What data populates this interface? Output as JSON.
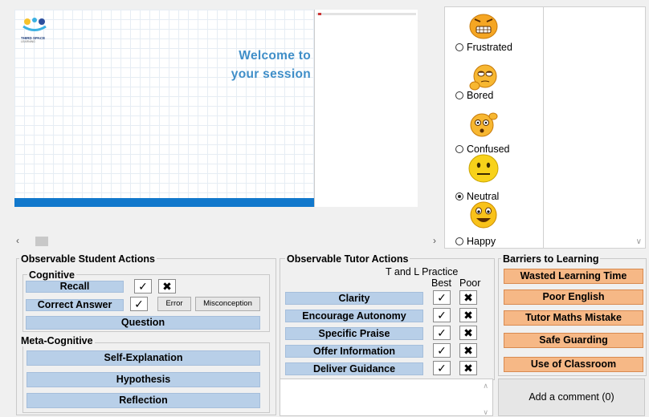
{
  "preview": {
    "logo_text": "THIRD SPACE",
    "logo_sub": "LEARNING",
    "welcome_line1": "Welcome to",
    "welcome_line2": "your session"
  },
  "scroll": {
    "left_arrow": "‹",
    "right_arrow": "›"
  },
  "emotions": {
    "items": [
      {
        "label": "Frustrated",
        "selected": false,
        "icon": "frustrated-face-icon"
      },
      {
        "label": "Bored",
        "selected": false,
        "icon": "bored-face-icon"
      },
      {
        "label": "Confused",
        "selected": false,
        "icon": "confused-face-icon"
      },
      {
        "label": "Neutral",
        "selected": true,
        "icon": "neutral-face-icon"
      },
      {
        "label": "Happy",
        "selected": false,
        "icon": "happy-face-icon"
      }
    ]
  },
  "student": {
    "title": "Observable Student Actions",
    "cognitive": {
      "title": "Cognitive",
      "recall": "Recall",
      "correct_answer": "Correct Answer",
      "error": "Error",
      "misconception": "Misconception",
      "question": "Question"
    },
    "meta": {
      "title": "Meta-Cognitive",
      "self_explanation": "Self-Explanation",
      "hypothesis": "Hypothesis",
      "reflection": "Reflection"
    }
  },
  "tutor": {
    "title": "Observable Tutor Actions",
    "practice_header": "T and L Practice",
    "best": "Best",
    "poor": "Poor",
    "rows": [
      "Clarity",
      "Encourage Autonomy",
      "Specific Praise",
      "Offer Information",
      "Deliver Guidance"
    ]
  },
  "barriers": {
    "title": "Barriers to Learning",
    "items": [
      "Wasted Learning Time",
      "Poor English",
      "Tutor Maths Mistake",
      "Safe Guarding",
      "Use of Classroom"
    ]
  },
  "marks": {
    "check": "✓",
    "cross": "✖"
  },
  "comment": {
    "add_label": "Add a comment (0)"
  },
  "colors": {
    "blue_button": "#b8cfe8",
    "orange_button": "#f6b886",
    "brand_blue": "#1178cc"
  }
}
